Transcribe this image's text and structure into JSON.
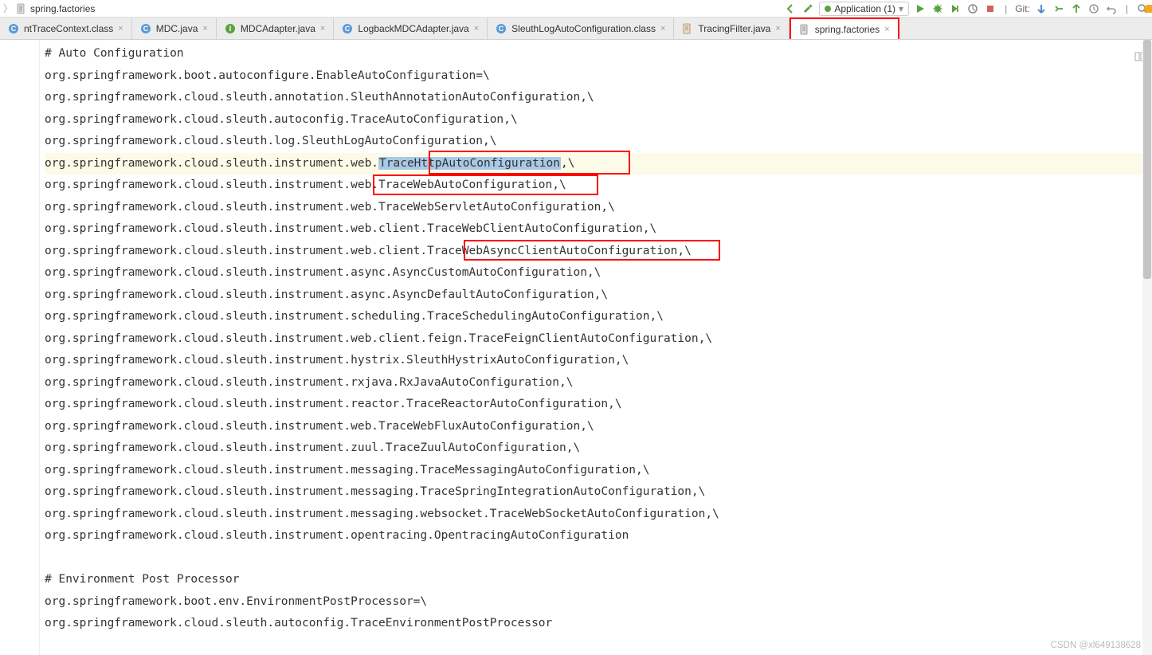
{
  "breadcrumb": {
    "file": "spring.factories"
  },
  "toolbar": {
    "run_config_label": "Application (1)",
    "git_label": "Git:"
  },
  "tabs": [
    {
      "label": "ntTraceContext.class",
      "icon_color": "#5c9ad6",
      "icon_letter": "C"
    },
    {
      "label": "MDC.java",
      "icon_color": "#5c9ad6",
      "icon_letter": "C"
    },
    {
      "label": "MDCAdapter.java",
      "icon_color": "#5aa33f",
      "icon_letter": "I"
    },
    {
      "label": "LogbackMDCAdapter.java",
      "icon_color": "#5c9ad6",
      "icon_letter": "C"
    },
    {
      "label": "SleuthLogAutoConfiguration.class",
      "icon_color": "#5c9ad6",
      "icon_letter": "C"
    },
    {
      "label": "TracingFilter.java",
      "icon_color": "#c67a34",
      "icon_letter": ""
    },
    {
      "label": "spring.factories",
      "icon_color": "#888",
      "icon_letter": "",
      "active": true
    }
  ],
  "code": {
    "lines": [
      "# Auto Configuration",
      "org.springframework.boot.autoconfigure.EnableAutoConfiguration=\\",
      "org.springframework.cloud.sleuth.annotation.SleuthAnnotationAutoConfiguration,\\",
      "org.springframework.cloud.sleuth.autoconfig.TraceAutoConfiguration,\\",
      "org.springframework.cloud.sleuth.log.SleuthLogAutoConfiguration,\\",
      "org.springframework.cloud.sleuth.instrument.web.TraceHttpAutoConfiguration,\\",
      "org.springframework.cloud.sleuth.instrument.web.TraceWebAutoConfiguration,\\",
      "org.springframework.cloud.sleuth.instrument.web.TraceWebServletAutoConfiguration,\\",
      "org.springframework.cloud.sleuth.instrument.web.client.TraceWebClientAutoConfiguration,\\",
      "org.springframework.cloud.sleuth.instrument.web.client.TraceWebAsyncClientAutoConfiguration,\\",
      "org.springframework.cloud.sleuth.instrument.async.AsyncCustomAutoConfiguration,\\",
      "org.springframework.cloud.sleuth.instrument.async.AsyncDefaultAutoConfiguration,\\",
      "org.springframework.cloud.sleuth.instrument.scheduling.TraceSchedulingAutoConfiguration,\\",
      "org.springframework.cloud.sleuth.instrument.web.client.feign.TraceFeignClientAutoConfiguration,\\",
      "org.springframework.cloud.sleuth.instrument.hystrix.SleuthHystrixAutoConfiguration,\\",
      "org.springframework.cloud.sleuth.instrument.rxjava.RxJavaAutoConfiguration,\\",
      "org.springframework.cloud.sleuth.instrument.reactor.TraceReactorAutoConfiguration,\\",
      "org.springframework.cloud.sleuth.instrument.web.TraceWebFluxAutoConfiguration,\\",
      "org.springframework.cloud.sleuth.instrument.zuul.TraceZuulAutoConfiguration,\\",
      "org.springframework.cloud.sleuth.instrument.messaging.TraceMessagingAutoConfiguration,\\",
      "org.springframework.cloud.sleuth.instrument.messaging.TraceSpringIntegrationAutoConfiguration,\\",
      "org.springframework.cloud.sleuth.instrument.messaging.websocket.TraceWebSocketAutoConfiguration,\\",
      "org.springframework.cloud.sleuth.instrument.opentracing.OpentracingAutoConfiguration",
      "",
      "# Environment Post Processor",
      "org.springframework.boot.env.EnvironmentPostProcessor=\\",
      "org.springframework.cloud.sleuth.autoconfig.TraceEnvironmentPostProcessor"
    ],
    "highlighted_line_index": 5,
    "selection_text": "TraceHttpAutoConfiguration"
  },
  "watermark": "CSDN @xl649138628"
}
